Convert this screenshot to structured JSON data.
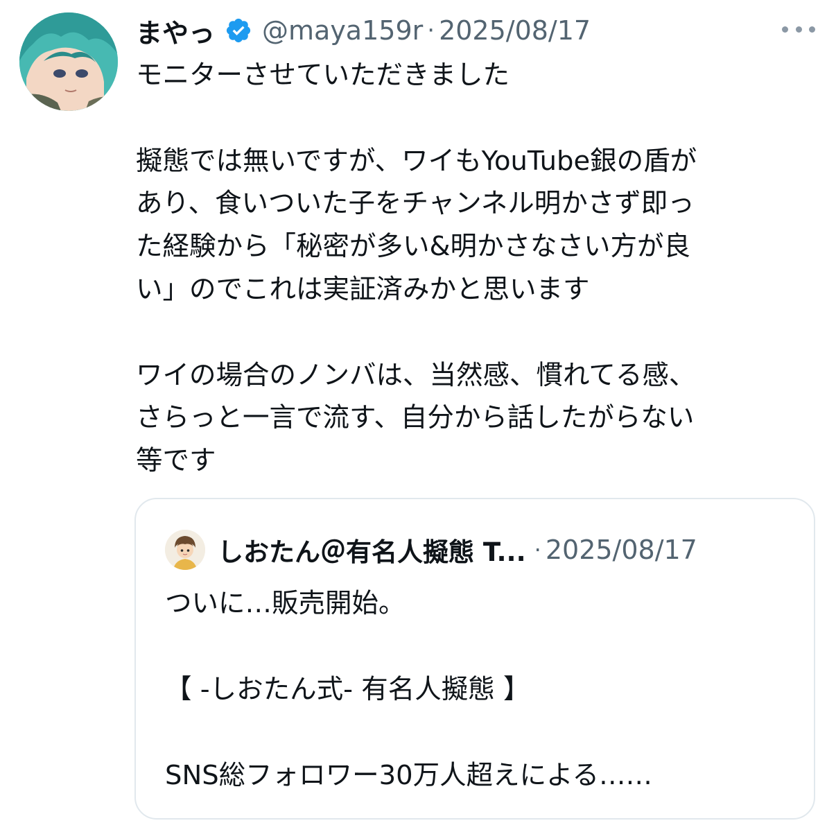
{
  "tweet": {
    "author": {
      "display_name": "まやっ",
      "handle": "@maya159r",
      "verified_icon": "verified-badge-icon",
      "avatar_icon": "anime-character-avatar"
    },
    "separator": "·",
    "date": "2025/08/17",
    "more_icon": "more-options-icon",
    "paragraphs": [
      [
        "モニターさせていただきました"
      ],
      [
        "擬態では無いですが、ワイもYouTube銀の盾が",
        "あり、食いついた子をチャンネル明かさず即っ",
        "た経験から「秘密が多い&明かさなさい方が良",
        "い」のでこれは実証済みかと思います"
      ],
      [
        "ワイの場合のノンバは、当然感、慣れてる感、",
        "さらっと一言で流す、自分から話したがらない",
        "等です"
      ]
    ]
  },
  "quoted_tweet": {
    "author": {
      "display_name": "しおたん＠有名人擬態 T...",
      "avatar_icon": "cartoon-boy-avatar"
    },
    "separator": "·",
    "date": "2025/08/17",
    "paragraphs": [
      [
        "ついに…販売開始。"
      ],
      [
        "【 -しおたん式- 有名人擬態 】"
      ],
      [
        "SNS総フォロワー30万人超えによる……"
      ]
    ]
  },
  "colors": {
    "text": "#0f1419",
    "secondary": "#536471",
    "verified": "#1d9bf0",
    "border": "#e1e8ed"
  }
}
